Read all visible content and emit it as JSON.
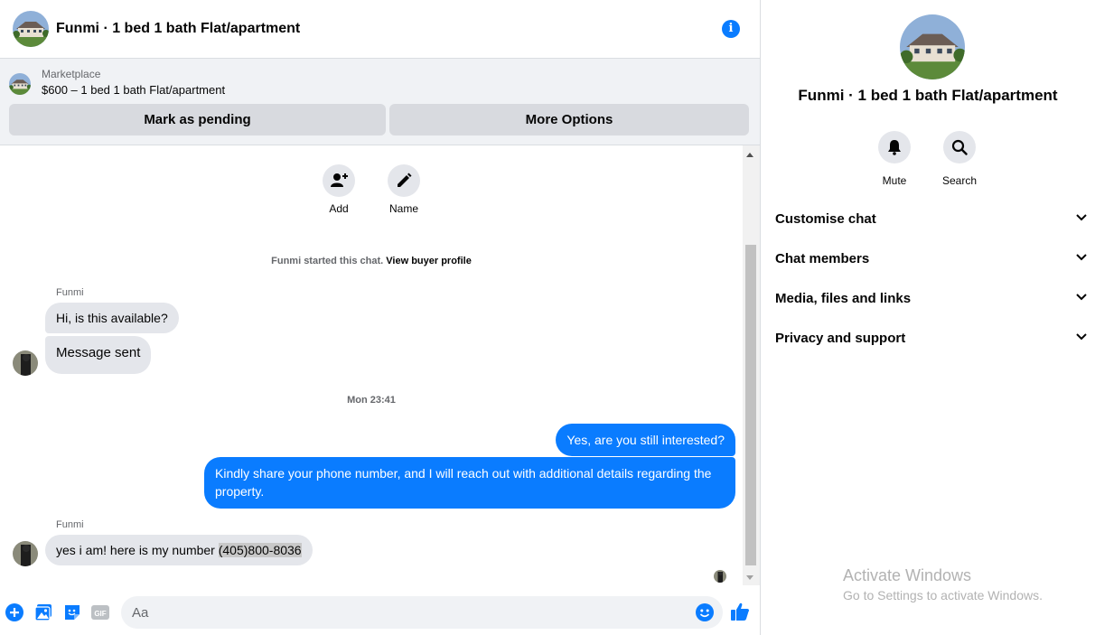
{
  "header": {
    "title": "Funmi · 1 bed 1 bath Flat/apartment",
    "info_icon": "info-icon"
  },
  "marketplace": {
    "label": "Marketplace",
    "listing": "$600 – 1 bed 1 bath Flat/apartment",
    "buttons": [
      "Mark as pending",
      "More Options"
    ]
  },
  "thread": {
    "actions": [
      {
        "label": "Add",
        "icon": "add-person-icon"
      },
      {
        "label": "Name",
        "icon": "pencil-icon"
      }
    ],
    "system_note": {
      "text": "Funmi started this chat.",
      "link": "View buyer profile"
    },
    "messages": [
      {
        "sender": "Funmi",
        "text": "Hi, is this available?"
      },
      {
        "text": "Message sent"
      },
      {
        "timestamp": "Mon 23:41"
      },
      {
        "text": "Yes, are you still interested?"
      },
      {
        "text": "Kindly share your phone number, and I will reach out with additional details regarding the property."
      },
      {
        "sender": "Funmi",
        "text": "yes i am! here is my number ",
        "phone": "(405)800-8036"
      }
    ]
  },
  "composer": {
    "placeholder": "Aa",
    "icons": [
      "plus-icon",
      "photo-icon",
      "sticker-icon",
      "gif-icon",
      "emoji-icon",
      "thumbs-up-icon"
    ],
    "gif_label": "GIF"
  },
  "panel": {
    "title": "Funmi · 1 bed 1 bath Flat/apartment",
    "actions": [
      {
        "label": "Mute",
        "icon": "bell-icon"
      },
      {
        "label": "Search",
        "icon": "search-icon"
      }
    ],
    "menu": [
      "Customise chat",
      "Chat members",
      "Media, files and links",
      "Privacy and support"
    ]
  },
  "watermark": {
    "line1": "Activate Windows",
    "line2": "Go to Settings to activate Windows."
  },
  "colors": {
    "accent": "#0a7cff",
    "bubble_in": "#e4e6eb",
    "bar": "#f0f2f5"
  }
}
